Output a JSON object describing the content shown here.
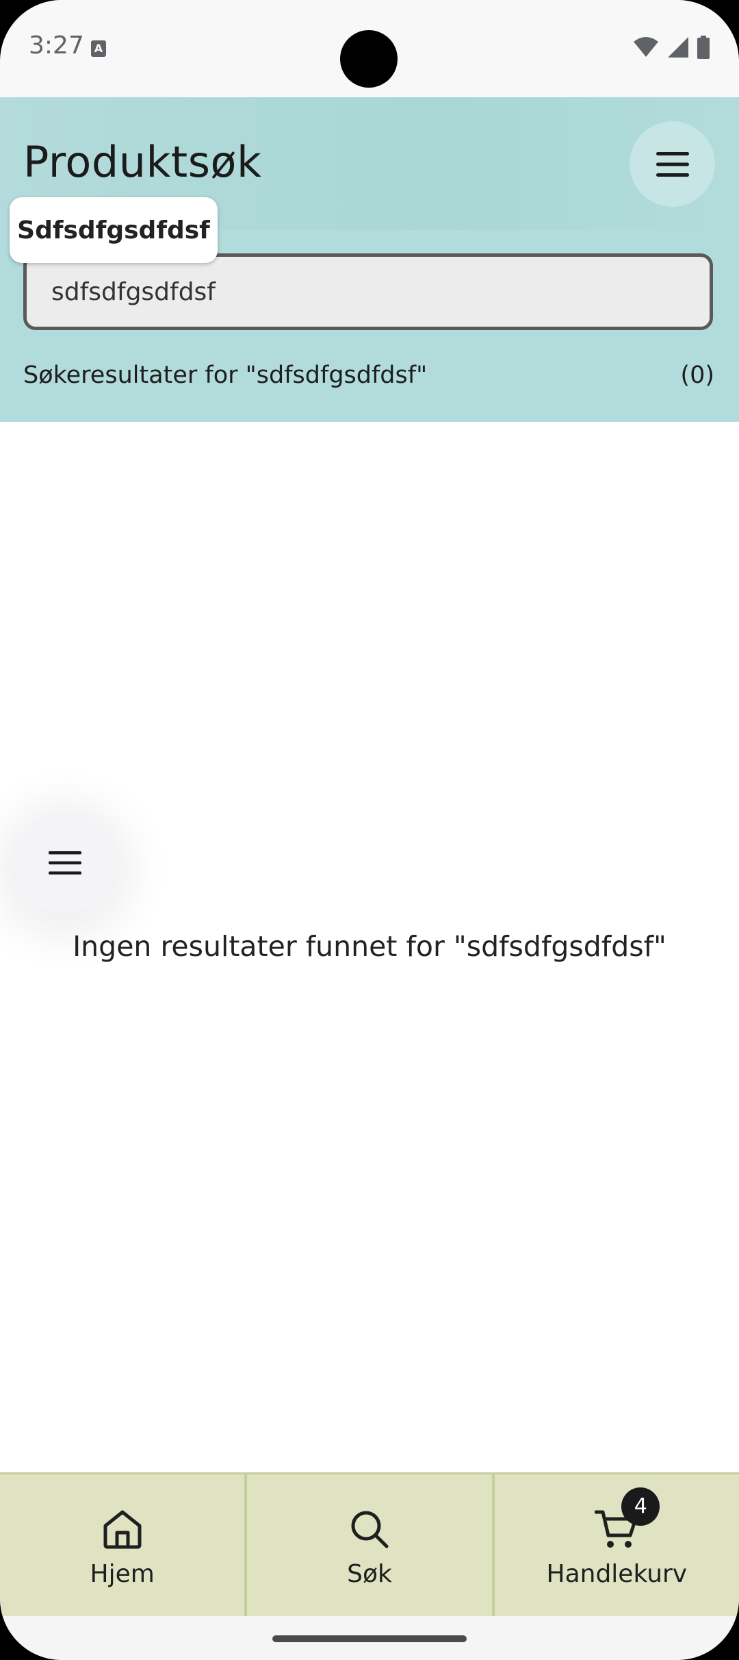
{
  "status_bar": {
    "time": "3:27",
    "notification_icon": "text-a-icon",
    "icons": [
      "wifi-icon",
      "signal-icon",
      "battery-icon"
    ]
  },
  "header": {
    "title": "Produktsøk",
    "menu_icon": "hamburger-menu-icon",
    "background_color": "#b2dcdb"
  },
  "tooltip": {
    "text": "Sdfsdfgsdfdsf"
  },
  "search": {
    "value": "sdfsdfgsdfdsf"
  },
  "results": {
    "label": "Søkeresultater for \"sdfsdfgsdfdsf\"",
    "count": "(0)"
  },
  "main": {
    "empty_message": "Ingen resultater funnet for \"sdfsdfgsdfdsf\"",
    "fab_icon": "menu-lines-icon"
  },
  "bottom_nav": {
    "background_color": "#dfe3c2",
    "items": [
      {
        "label": "Hjem",
        "icon": "home-icon"
      },
      {
        "label": "Søk",
        "icon": "search-icon"
      },
      {
        "label": "Handlekurv",
        "icon": "cart-icon",
        "badge": "4"
      }
    ]
  }
}
